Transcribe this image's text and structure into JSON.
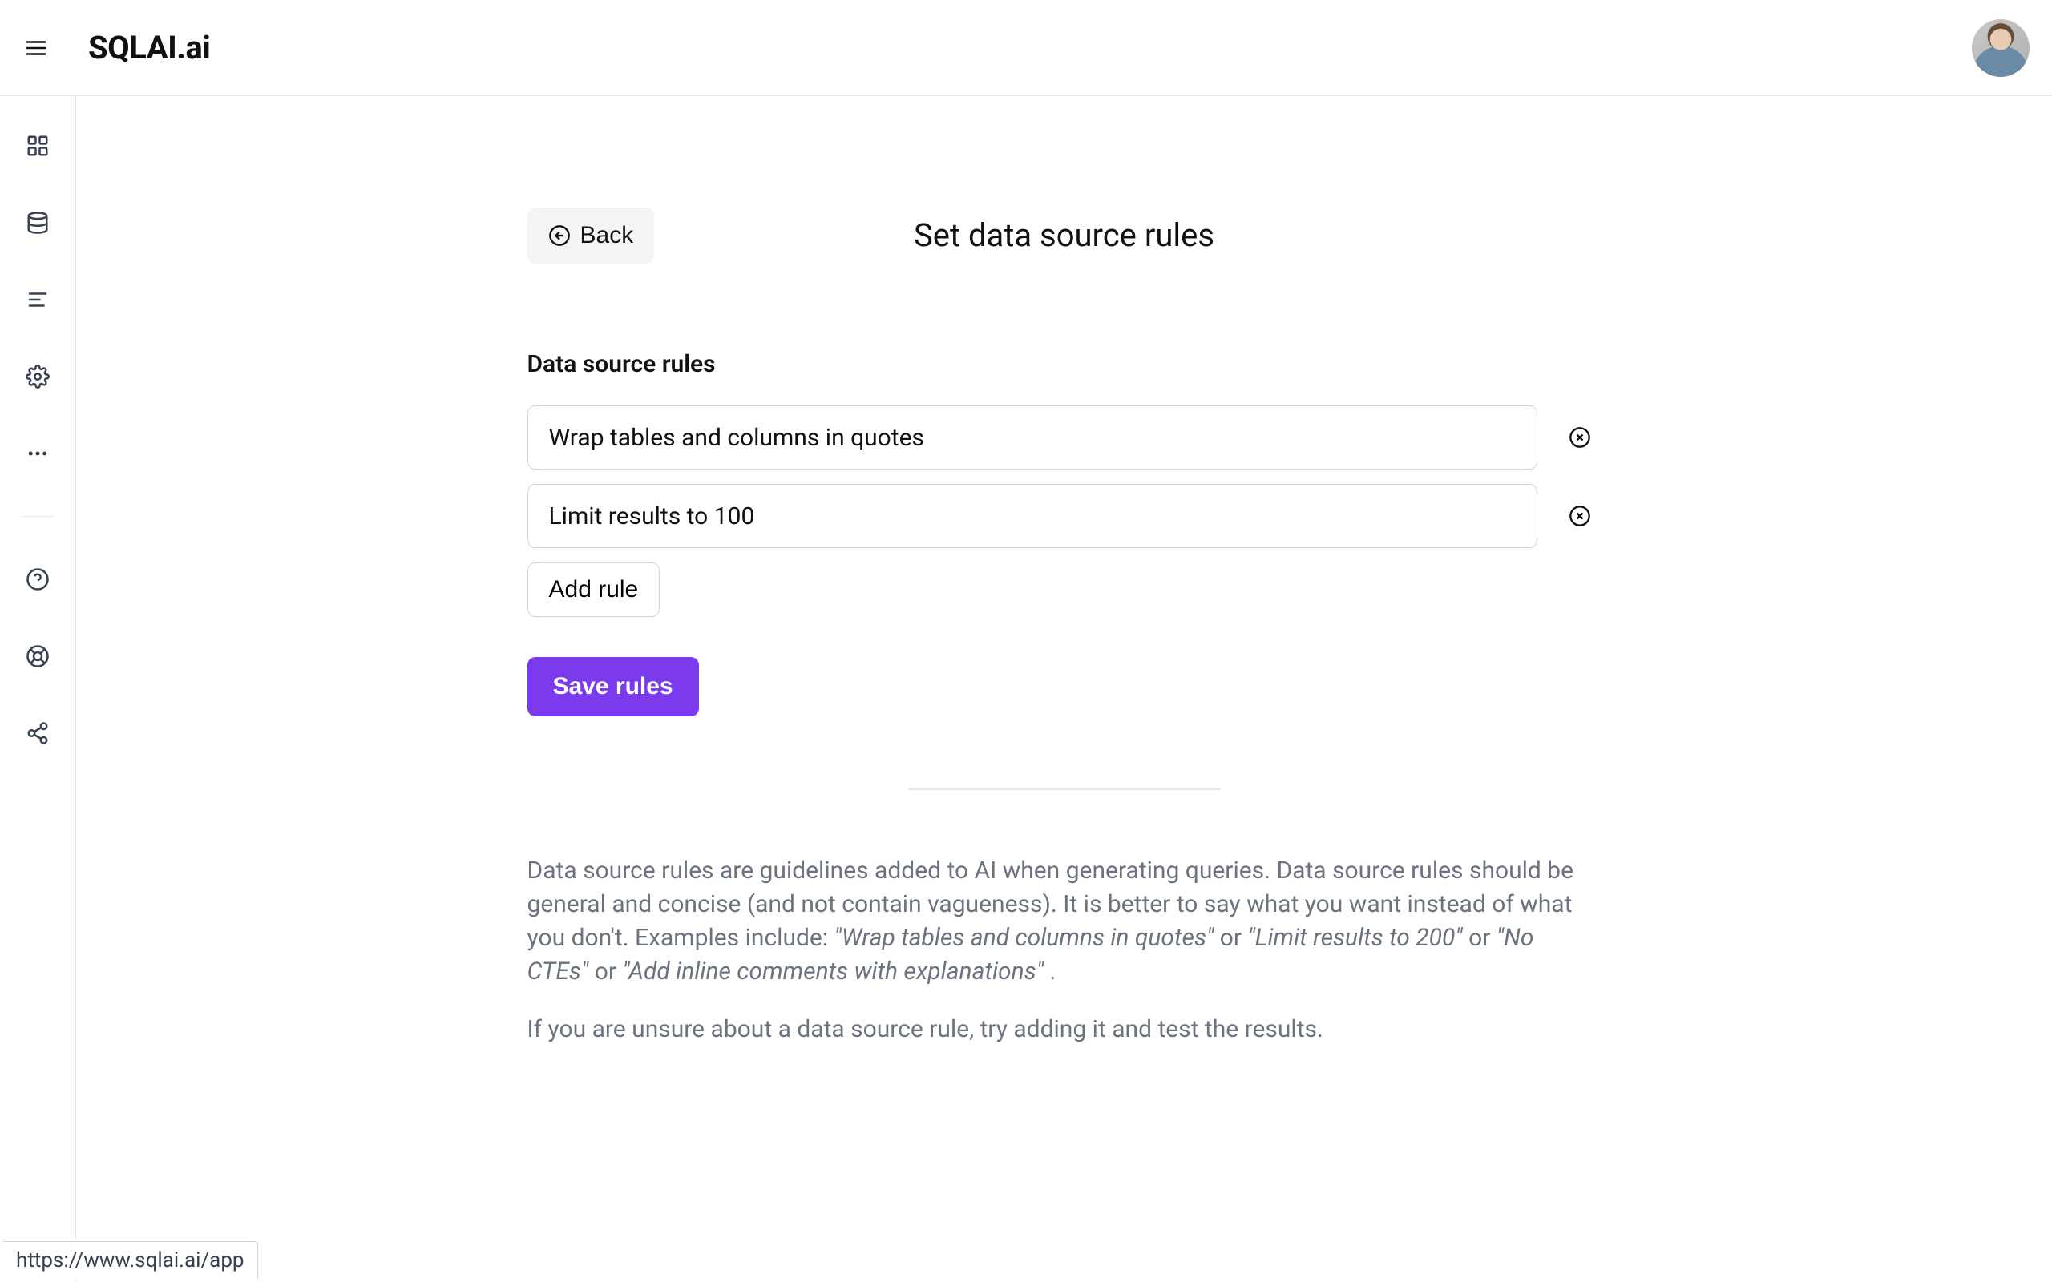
{
  "header": {
    "logo": "SQLAI.ai"
  },
  "page": {
    "back_label": "Back",
    "title": "Set data source rules",
    "section_label": "Data source rules"
  },
  "rules": [
    {
      "value": "Wrap tables and columns in quotes"
    },
    {
      "value": "Limit results to 100"
    }
  ],
  "buttons": {
    "add_rule": "Add rule",
    "save": "Save rules"
  },
  "help": {
    "p1_a": "Data source rules are guidelines added to AI when generating queries. Data source rules should be general and concise (and not contain vagueness). It is better to say what you want instead of what you don't. Examples include: ",
    "ex1": "\"Wrap tables and columns in quotes\"",
    "or1": " or ",
    "ex2": "\"Limit results to 200\"",
    "or2": " or ",
    "ex3": "\"No CTEs\"",
    "or3": " or ",
    "ex4": "\"Add inline comments with explanations\"",
    "p1_b": ".",
    "p2": "If you are unsure about a data source rule, try adding it and test the results."
  },
  "status_url": "https://www.sqlai.ai/app"
}
